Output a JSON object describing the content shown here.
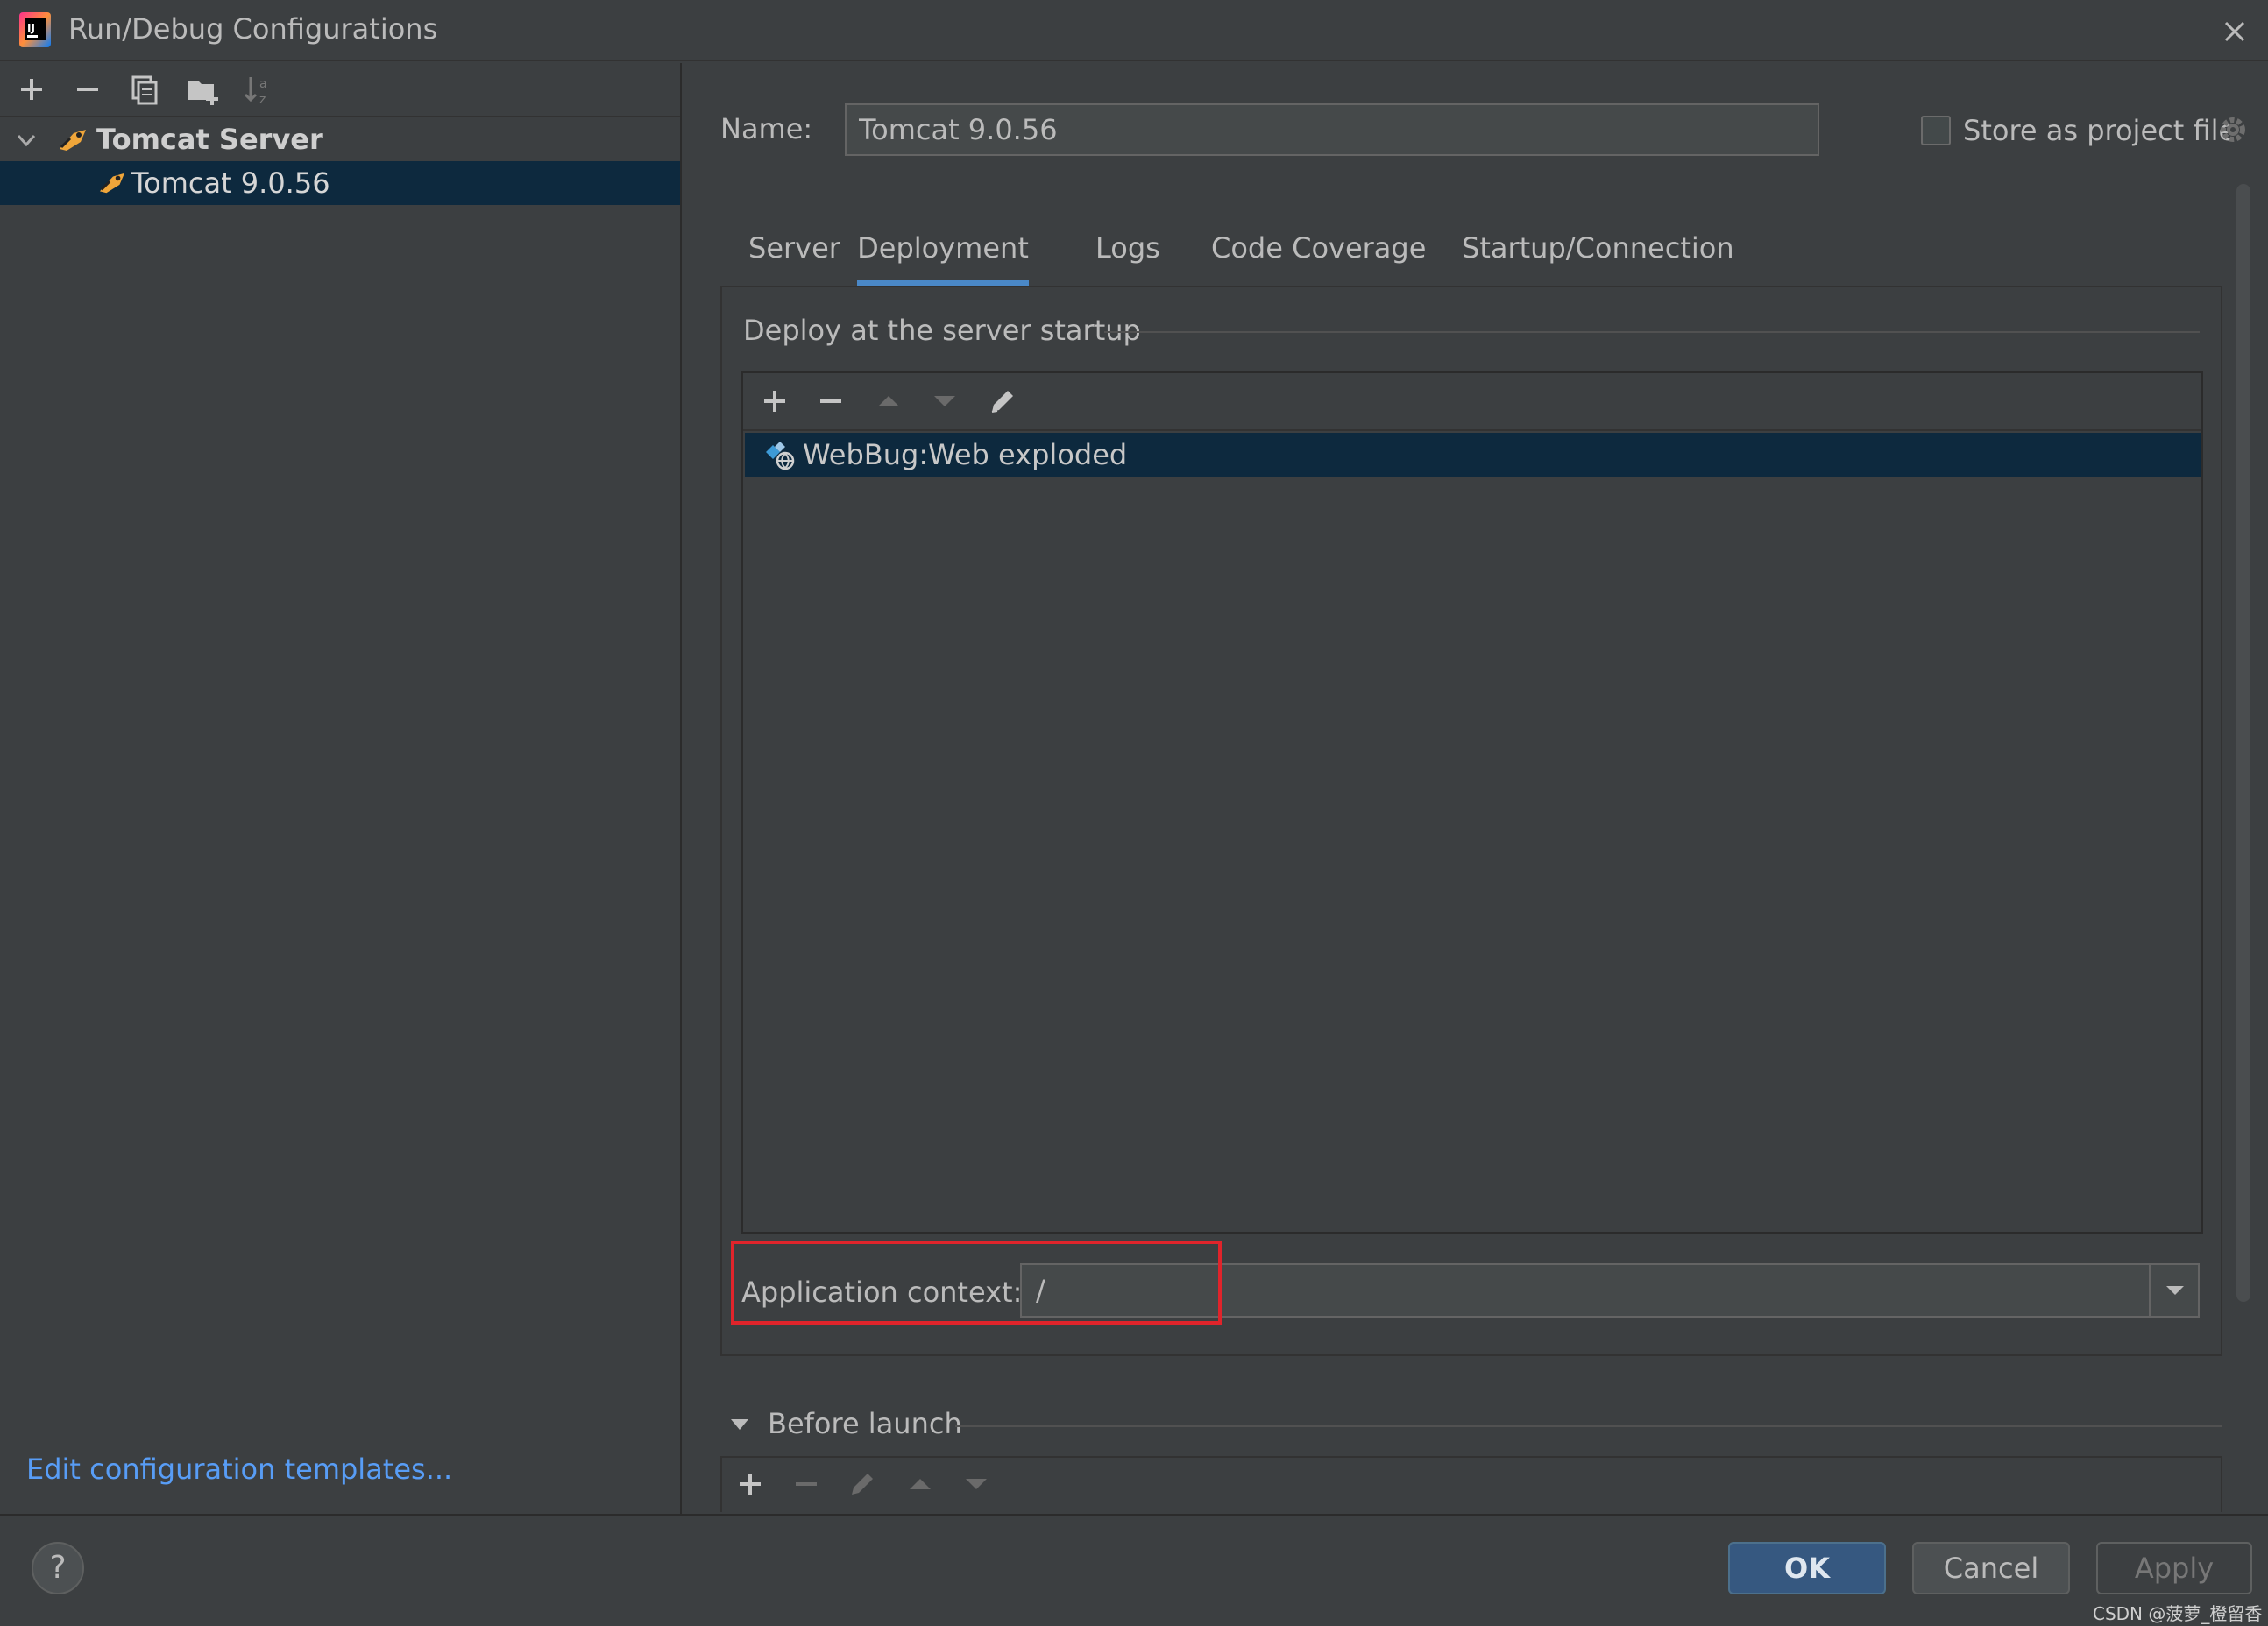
{
  "window": {
    "title": "Run/Debug Configurations"
  },
  "left_toolbar": {
    "icons": [
      "add-icon",
      "remove-icon",
      "copy-icon",
      "folder-add-icon",
      "sort-icon"
    ]
  },
  "tree": {
    "group_label": "Tomcat Server",
    "child_label": "Tomcat 9.0.56"
  },
  "edit_templates_link": "Edit configuration templates...",
  "name_field": {
    "label": "Name:",
    "value": "Tomcat 9.0.56"
  },
  "store_as_project_file": {
    "label": "Store as project file",
    "checked": false
  },
  "tabs": [
    {
      "label": "Server",
      "active": false
    },
    {
      "label": "Deployment",
      "active": true
    },
    {
      "label": "Logs",
      "active": false
    },
    {
      "label": "Code Coverage",
      "active": false
    },
    {
      "label": "Startup/Connection",
      "active": false
    }
  ],
  "deployment": {
    "section_title": "Deploy at the server startup",
    "artifacts": [
      "WebBug:Web exploded"
    ],
    "application_context": {
      "label": "Application context:",
      "value": "/"
    }
  },
  "before_launch": {
    "label": "Before launch"
  },
  "buttons": {
    "help": "?",
    "ok": "OK",
    "cancel": "Cancel",
    "apply": "Apply"
  },
  "watermark": "CSDN @菠萝_橙留香",
  "colors": {
    "background": "#3c3f41",
    "selection": "#0d293e",
    "accent": "#4a88c7",
    "link": "#589df6",
    "highlight_box": "#e0242b",
    "ok_button": "#365880"
  }
}
